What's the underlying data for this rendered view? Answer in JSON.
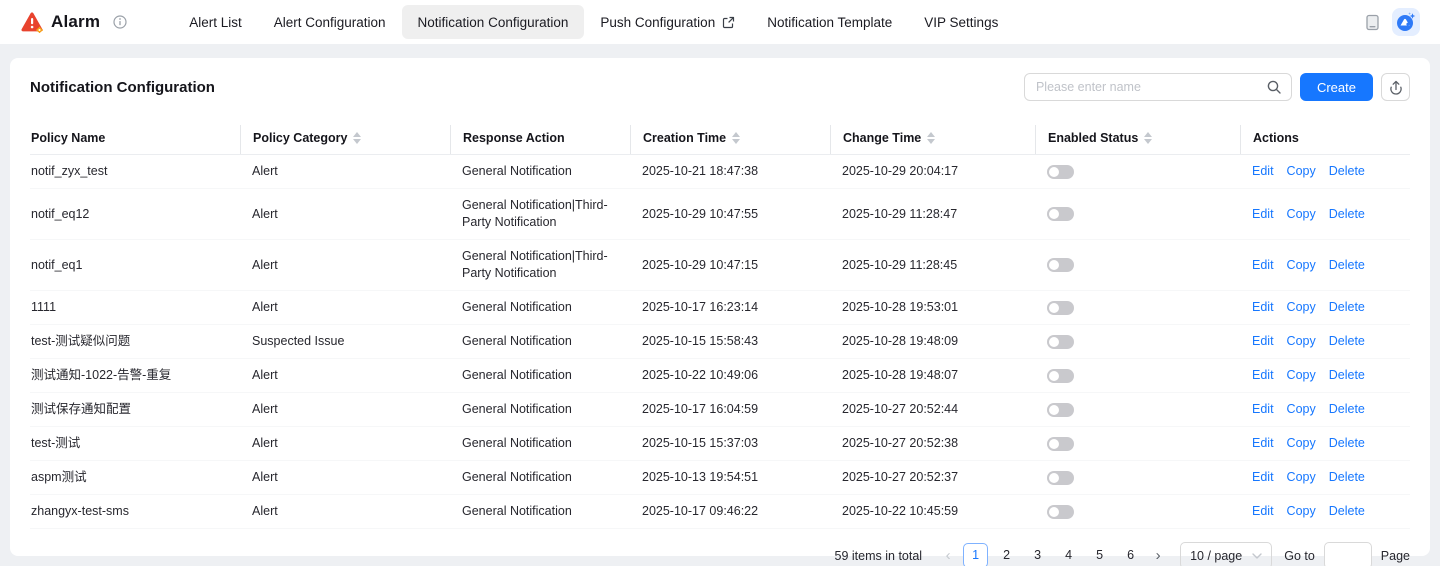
{
  "topbar": {
    "logo_text": "Alarm",
    "nav": [
      {
        "label": "Alert List",
        "active": false,
        "external": false
      },
      {
        "label": "Alert Configuration",
        "active": false,
        "external": false
      },
      {
        "label": "Notification Configuration",
        "active": true,
        "external": false
      },
      {
        "label": "Push Configuration",
        "active": false,
        "external": true
      },
      {
        "label": "Notification Template",
        "active": false,
        "external": false
      },
      {
        "label": "VIP Settings",
        "active": false,
        "external": false
      }
    ]
  },
  "toolbar": {
    "title": "Notification Configuration",
    "search_placeholder": "Please enter name",
    "create_label": "Create"
  },
  "table": {
    "columns": [
      {
        "label": "Policy Name",
        "sortable": false
      },
      {
        "label": "Policy Category",
        "sortable": true
      },
      {
        "label": "Response Action",
        "sortable": false
      },
      {
        "label": "Creation Time",
        "sortable": true
      },
      {
        "label": "Change Time",
        "sortable": true
      },
      {
        "label": "Enabled Status",
        "sortable": true
      },
      {
        "label": "Actions",
        "sortable": false
      }
    ],
    "action_labels": [
      "Edit",
      "Copy",
      "Delete"
    ],
    "rows": [
      {
        "name": "notif_zyx_test",
        "category": "Alert",
        "response_action": "General Notification",
        "creation_time": "2025-10-21 18:47:38",
        "change_time": "2025-10-29 20:04:17",
        "enabled": false
      },
      {
        "name": "notif_eq12",
        "category": "Alert",
        "response_action": "General Notification|Third-Party Notification",
        "creation_time": "2025-10-29 10:47:55",
        "change_time": "2025-10-29 11:28:47",
        "enabled": false
      },
      {
        "name": "notif_eq1",
        "category": "Alert",
        "response_action": "General Notification|Third-Party Notification",
        "creation_time": "2025-10-29 10:47:15",
        "change_time": "2025-10-29 11:28:45",
        "enabled": false
      },
      {
        "name": "1111",
        "category": "Alert",
        "response_action": "General Notification",
        "creation_time": "2025-10-17 16:23:14",
        "change_time": "2025-10-28 19:53:01",
        "enabled": false
      },
      {
        "name": "test-测试疑似问题",
        "category": "Suspected Issue",
        "response_action": "General Notification",
        "creation_time": "2025-10-15 15:58:43",
        "change_time": "2025-10-28 19:48:09",
        "enabled": false
      },
      {
        "name": "测试通知-1022-告警-重复",
        "category": "Alert",
        "response_action": "General Notification",
        "creation_time": "2025-10-22 10:49:06",
        "change_time": "2025-10-28 19:48:07",
        "enabled": false
      },
      {
        "name": "测试保存通知配置",
        "category": "Alert",
        "response_action": "General Notification",
        "creation_time": "2025-10-17 16:04:59",
        "change_time": "2025-10-27 20:52:44",
        "enabled": false
      },
      {
        "name": "test-测试",
        "category": "Alert",
        "response_action": "General Notification",
        "creation_time": "2025-10-15 15:37:03",
        "change_time": "2025-10-27 20:52:38",
        "enabled": false
      },
      {
        "name": "aspm测试",
        "category": "Alert",
        "response_action": "General Notification",
        "creation_time": "2025-10-13 19:54:51",
        "change_time": "2025-10-27 20:52:37",
        "enabled": false
      },
      {
        "name": "zhangyx-test-sms",
        "category": "Alert",
        "response_action": "General Notification",
        "creation_time": "2025-10-17 09:46:22",
        "change_time": "2025-10-22 10:45:59",
        "enabled": false
      }
    ]
  },
  "pagination": {
    "total_text": "59 items in total",
    "pages": [
      "1",
      "2",
      "3",
      "4",
      "5",
      "6"
    ],
    "current_page": "1",
    "page_size": "10 / page",
    "goto_label": "Go to",
    "page_label": "Page"
  },
  "icons": {
    "logo": "alarm-triangle-icon",
    "info": "info-circle-icon",
    "external": "external-link-icon",
    "device": "device-icon",
    "assistant": "ai-assistant-icon",
    "search": "search-icon",
    "export": "export-icon",
    "sort": "sort-caret-icon",
    "prev": "chevron-left-icon",
    "next": "chevron-right-icon",
    "select_arrow": "chevron-down-icon"
  },
  "colors": {
    "accent_blue": "#1677ff",
    "logo_red": "#e8432e",
    "logo_orange": "#f7a21b",
    "active_nav_bg": "#efefef"
  }
}
